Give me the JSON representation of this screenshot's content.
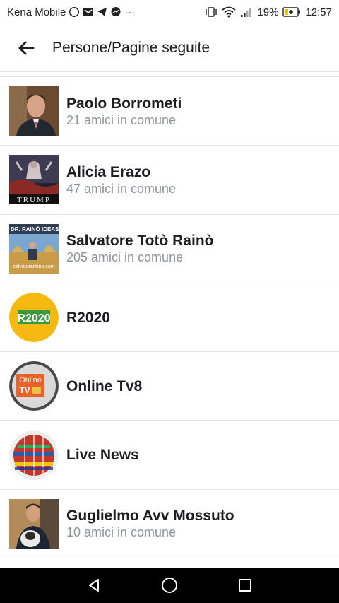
{
  "status": {
    "carrier": "Kena Mobile",
    "more": "···",
    "battery": "19%",
    "time": "12:57"
  },
  "header": {
    "title": "Persone/Pagine seguite"
  },
  "items": [
    {
      "name": "Paolo Borrometi",
      "subtitle": "21 amici in comune"
    },
    {
      "name": "Alicia Erazo",
      "subtitle": "47 amici in comune",
      "avatar_text": "TRUMP"
    },
    {
      "name": "Salvatore Totò Rainò",
      "subtitle": "205 amici in comune",
      "avatar_text": "DR. RAINÒ IDEAS",
      "avatar_subtext": "salvatoreraino.com"
    },
    {
      "name": "R2020",
      "avatar_text": "R2020"
    },
    {
      "name": "Online Tv8",
      "avatar_text": "Online",
      "avatar_text2": "TV"
    },
    {
      "name": "Live News"
    },
    {
      "name": "Guglielmo Avv Mossuto",
      "subtitle": "10 amici in comune"
    }
  ],
  "colors": {
    "accent_yellow": "#f5b90f",
    "r2020_green": "#3c9a3c",
    "online_orange": "#e9622b",
    "divider": "#e4e6eb",
    "secondary_text": "#8d949e"
  }
}
